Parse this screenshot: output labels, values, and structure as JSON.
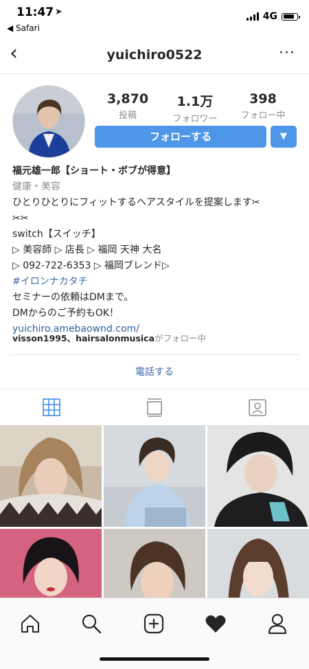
{
  "status": {
    "time": "11:47",
    "back_app": "Safari",
    "network": "4G"
  },
  "nav": {
    "back_glyph": "‹",
    "username": "yuichiro0522",
    "more_glyph": "···"
  },
  "profile": {
    "stats": [
      {
        "value": "3,870",
        "label": "投稿"
      },
      {
        "value": "1.1万",
        "label": "フォロワー"
      },
      {
        "value": "398",
        "label": "フォロー中"
      }
    ],
    "follow_button": "フォローする",
    "dropdown_glyph": "▼",
    "accent_color": "#4e96e8"
  },
  "bio": {
    "name": "福元雄一郎【ショート・ボブが得意】",
    "category": "健康・美容",
    "lines": [
      "ひとりひとりにフィットするヘアスタイルを提案します✂︎",
      "✂︎✂︎",
      "switch【スイッチ】",
      "▷ 美容師 ▷ 店長 ▷ 福岡 天神 大名",
      "▷ 092-722-6353 ▷ 福岡ブレンド▷"
    ],
    "hashtag": "#イロンナカタチ",
    "lines2": [
      "セミナーの依頼はDMまで。",
      "DMからのご予約もOK！"
    ],
    "website": "yuichiro.amebaownd.com/",
    "followed_by_users": "visson1995、hairsalonmusica",
    "followed_by_suffix": "がフォロー中"
  },
  "call_button": "電話する",
  "tabs": [
    "grid-tab",
    "feed-tab",
    "tagged-tab"
  ],
  "bottom_nav": [
    "home",
    "search",
    "new-post",
    "activity",
    "profile"
  ]
}
